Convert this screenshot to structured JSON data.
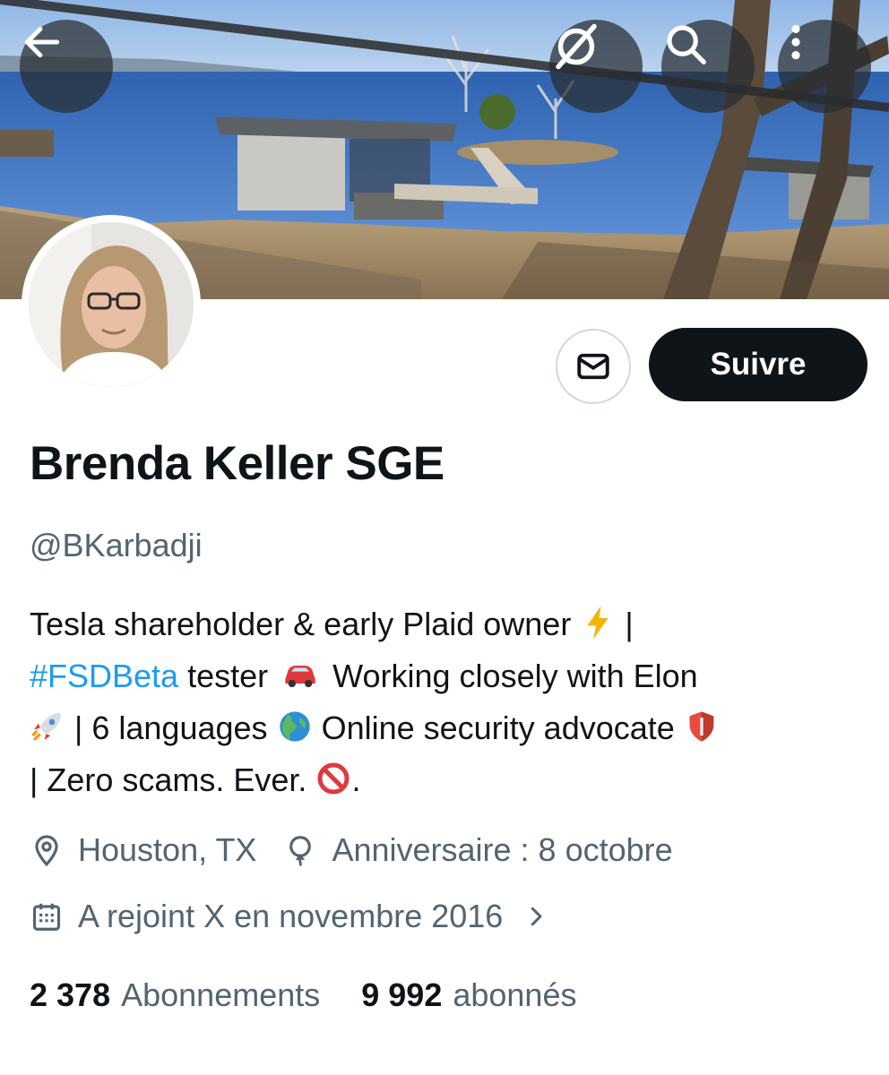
{
  "banner": {
    "image_description": "lakeside-boathouse-photo"
  },
  "header_actions": {
    "back_icon": "arrow-left-icon",
    "grok_icon": "grok-slash-icon",
    "search_icon": "search-icon",
    "more_icon": "more-vertical-icon"
  },
  "profile": {
    "display_name": "Brenda Keller SGE",
    "handle": "@BKarbadji",
    "follow_label": "Suivre",
    "message_icon": "envelope-icon"
  },
  "bio": {
    "line1_a": "Tesla shareholder & early Plaid owner",
    "line1_b": "|",
    "line2_hashtag": "#FSDBeta",
    "line2_a": "tester",
    "line2_b": "Working closely with Elon",
    "line3_a": "| 6 languages",
    "line3_b": "Online security advocate",
    "line4_a": "| Zero scams. Ever.",
    "line4_b": "."
  },
  "meta": {
    "location": "Houston, TX",
    "birthday": "Anniversaire : 8 octobre",
    "joined": "A rejoint X en novembre 2016"
  },
  "stats": {
    "following_count": "2 378",
    "following_label": "Abonnements",
    "followers_count": "9 992",
    "followers_label": "abonnés"
  },
  "colors": {
    "accent_link": "#1d9bf0",
    "text_primary": "#0f1419",
    "text_secondary": "#536471",
    "follow_button_bg": "#0f1419"
  }
}
